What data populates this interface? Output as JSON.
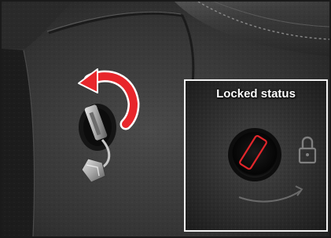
{
  "inset": {
    "title": "Locked status"
  },
  "colors": {
    "arrow": "#e8262b",
    "indicator": "#e3262b",
    "inset_border": "#f2f2f2",
    "frame_border": "#1a1a1a"
  },
  "icons": {
    "rotate_arrow": "curved-arrow-icon",
    "lock": "padlock-icon"
  }
}
